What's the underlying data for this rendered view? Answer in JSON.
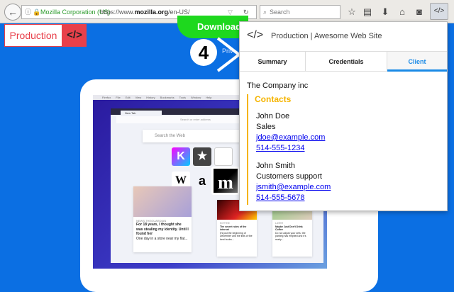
{
  "browser": {
    "identity": "Mozilla Corporation (US)",
    "url_prefix": "https://www.",
    "url_domain": "mozilla.org",
    "url_path": "/en-US/",
    "search_placeholder": "Search",
    "extension_icon": "</>"
  },
  "page": {
    "env_label": "Production",
    "env_icon": "</>",
    "download": "Download",
    "step": "4",
    "privacy": "Priv"
  },
  "mockup": {
    "menu": [
      "Firefox",
      "File",
      "Edit",
      "View",
      "History",
      "Bookmarks",
      "Tools",
      "Window",
      "Help"
    ],
    "tab": "New Tab",
    "address_placeholder": "Search or enter address",
    "search": "Search the Web",
    "tiles": [
      "K",
      "★",
      "W",
      "a",
      "m"
    ],
    "cards": [
      {
        "source": "NEWS.THEGUARDIAN",
        "title": "For 18 years, I thought she was stealing my identity. Until I found her",
        "excerpt": "One day in a store near my flat..."
      },
      {
        "source": "KOTTKE",
        "title": "The secret rules of the internet",
        "excerpt": "It's just the beginning of December and the lists of the best books..."
      },
      {
        "source": "LATER",
        "title": "Maybe Just Don't Drink Coffee",
        "excerpt": "Do not adjust your sets: the panting has emptied and it's ready..."
      }
    ]
  },
  "popup": {
    "icon": "</>",
    "title": "Production | Awesome Web Site",
    "tabs": [
      "Summary",
      "Credentials",
      "Client"
    ],
    "active_tab": "Client",
    "company": "The Company inc",
    "contacts_heading": "Contacts",
    "contacts": [
      {
        "name": "John Doe",
        "role": "Sales",
        "email": "jdoe@example.com",
        "phone": "514-555-1234"
      },
      {
        "name": "John Smith",
        "role": "Customers support",
        "email": "jsmith@example.com",
        "phone": "514-555-5678"
      }
    ]
  },
  "colors": {
    "accent": "#1a8ae6",
    "contacts": "#f5b400",
    "env": "#e8404a",
    "page_bg": "#0b6fe3"
  }
}
